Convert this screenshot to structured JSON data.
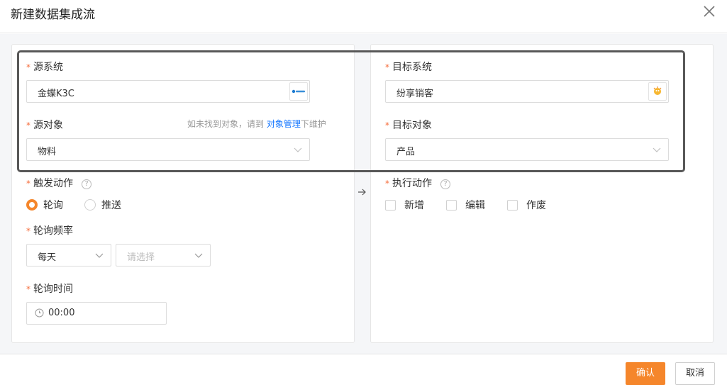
{
  "dialog": {
    "title": "新建数据集成流"
  },
  "source": {
    "system_label": "源系统",
    "system_value": "金蝶K3C",
    "object_label": "源对象",
    "object_hint_prefix": "如未找到对象，请到",
    "object_hint_link": "对象管理",
    "object_hint_suffix": "下维护",
    "object_value": "物料",
    "trigger_label": "触发动作",
    "trigger_options": [
      "轮询",
      "推送"
    ],
    "trigger_selected": "轮询",
    "frequency_label": "轮询频率",
    "frequency_value": "每天",
    "frequency_placeholder": "请选择",
    "time_label": "轮询时间",
    "time_value": "00:00"
  },
  "target": {
    "system_label": "目标系统",
    "system_value": "纷享销客",
    "object_label": "目标对象",
    "object_value": "产品",
    "action_label": "执行动作",
    "action_options": [
      "新增",
      "编辑",
      "作废"
    ]
  },
  "icons": {
    "help": "?",
    "required_mark": "*"
  },
  "footer": {
    "confirm_label": "确认",
    "cancel_label": "取消"
  },
  "colors": {
    "accent": "#f5862b",
    "link": "#1677ff",
    "required": "#f56c3b"
  }
}
